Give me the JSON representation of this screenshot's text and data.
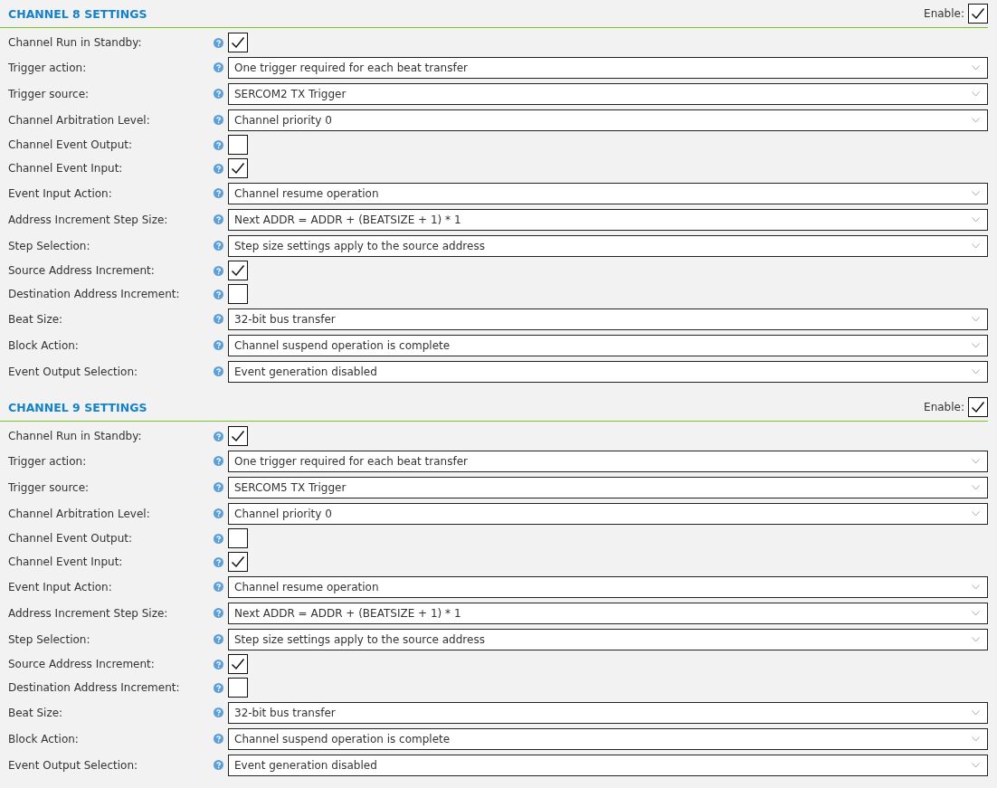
{
  "sections": [
    {
      "title": "CHANNEL 8 SETTINGS",
      "enable_label": "Enable:",
      "enabled": true,
      "settings": [
        {
          "label": "Channel Run in Standby:",
          "kind": "checkbox",
          "checked": true
        },
        {
          "label": "Trigger action:",
          "kind": "select",
          "value": "One trigger required for each beat transfer"
        },
        {
          "label": "Trigger source:",
          "kind": "select",
          "value": "SERCOM2 TX Trigger"
        },
        {
          "label": "Channel Arbitration Level:",
          "kind": "select",
          "value": "Channel priority 0"
        },
        {
          "label": "Channel Event Output:",
          "kind": "checkbox",
          "checked": false
        },
        {
          "label": "Channel Event Input:",
          "kind": "checkbox",
          "checked": true
        },
        {
          "label": "Event Input Action:",
          "kind": "select",
          "value": "Channel resume operation"
        },
        {
          "label": "Address Increment Step Size:",
          "kind": "select",
          "value": "Next ADDR = ADDR + (BEATSIZE + 1) * 1"
        },
        {
          "label": "Step Selection:",
          "kind": "select",
          "value": "Step size settings apply to the source address"
        },
        {
          "label": "Source Address Increment:",
          "kind": "checkbox",
          "checked": true
        },
        {
          "label": "Destination Address Increment:",
          "kind": "checkbox",
          "checked": false
        },
        {
          "label": "Beat Size:",
          "kind": "select",
          "value": "32-bit bus transfer"
        },
        {
          "label": "Block Action:",
          "kind": "select",
          "value": "Channel suspend operation is complete"
        },
        {
          "label": "Event Output Selection:",
          "kind": "select",
          "value": "Event generation disabled"
        }
      ]
    },
    {
      "title": "CHANNEL 9 SETTINGS",
      "enable_label": "Enable:",
      "enabled": true,
      "settings": [
        {
          "label": "Channel Run in Standby:",
          "kind": "checkbox",
          "checked": true
        },
        {
          "label": "Trigger action:",
          "kind": "select",
          "value": "One trigger required for each beat transfer"
        },
        {
          "label": "Trigger source:",
          "kind": "select",
          "value": "SERCOM5 TX Trigger"
        },
        {
          "label": "Channel Arbitration Level:",
          "kind": "select",
          "value": "Channel priority 0"
        },
        {
          "label": "Channel Event Output:",
          "kind": "checkbox",
          "checked": false
        },
        {
          "label": "Channel Event Input:",
          "kind": "checkbox",
          "checked": true
        },
        {
          "label": "Event Input Action:",
          "kind": "select",
          "value": "Channel resume operation"
        },
        {
          "label": "Address Increment Step Size:",
          "kind": "select",
          "value": "Next ADDR = ADDR + (BEATSIZE + 1) * 1"
        },
        {
          "label": "Step Selection:",
          "kind": "select",
          "value": "Step size settings apply to the source address"
        },
        {
          "label": "Source Address Increment:",
          "kind": "checkbox",
          "checked": true
        },
        {
          "label": "Destination Address Increment:",
          "kind": "checkbox",
          "checked": false
        },
        {
          "label": "Beat Size:",
          "kind": "select",
          "value": "32-bit bus transfer"
        },
        {
          "label": "Block Action:",
          "kind": "select",
          "value": "Channel suspend operation is complete"
        },
        {
          "label": "Event Output Selection:",
          "kind": "select",
          "value": "Event generation disabled"
        }
      ]
    }
  ]
}
